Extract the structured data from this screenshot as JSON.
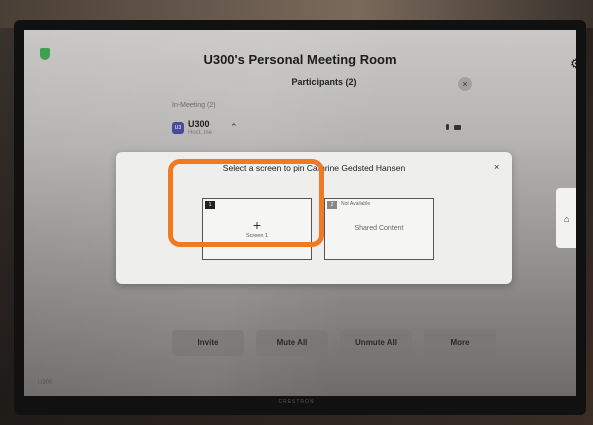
{
  "room": {
    "title": "U300's Personal Meeting Room"
  },
  "participants_panel": {
    "title": "Participants (2)",
    "close": "×",
    "section_label": "In-Meeting (2)",
    "participant": {
      "avatar": "U3",
      "name": "U300",
      "role": "Host, me",
      "chevron": "⌃"
    }
  },
  "dialog": {
    "title": "Select a screen to pin Cathrine Gedsted Hansen",
    "close": "×",
    "screens": [
      {
        "number": "1",
        "plus": "+",
        "label": "Screen 1"
      },
      {
        "number": "2",
        "status": "Not Available",
        "label": "Shared Content"
      }
    ]
  },
  "side": {
    "home": "⌂"
  },
  "actions": [
    "Invite",
    "Mute All",
    "Unmute All",
    "More"
  ],
  "footer": {
    "left": "U300",
    "brand": "CRESTRON"
  },
  "colors": {
    "highlight": "#f07a22",
    "shield": "#3fa14b"
  }
}
